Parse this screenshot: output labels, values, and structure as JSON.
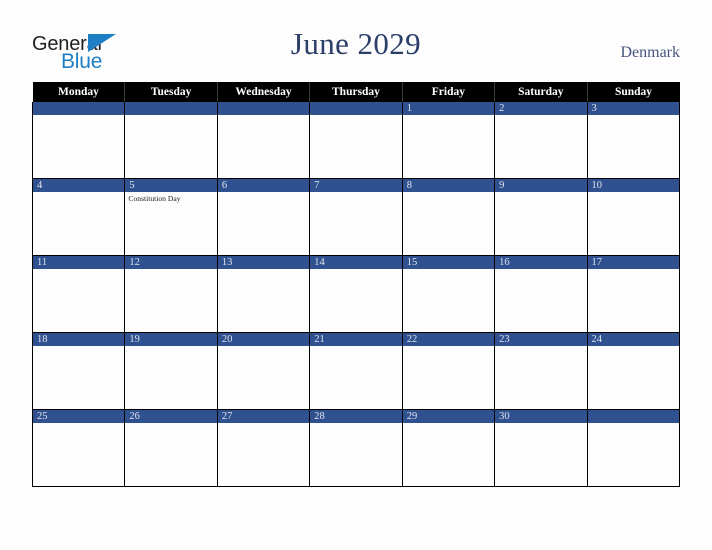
{
  "logo": {
    "word_one": "General",
    "word_two": "Blue",
    "accent_color": "#1e7fc4"
  },
  "header": {
    "title": "June 2029",
    "country": "Denmark",
    "title_color": "#2b3e68"
  },
  "calendar": {
    "weekday_headers": [
      "Monday",
      "Tuesday",
      "Wednesday",
      "Thursday",
      "Friday",
      "Saturday",
      "Sunday"
    ],
    "header_bg": "#000000",
    "day_bar_color": "#2f5190",
    "day_number_color": "#dfe3ec",
    "weeks": [
      [
        {
          "day": "",
          "events": []
        },
        {
          "day": "",
          "events": []
        },
        {
          "day": "",
          "events": []
        },
        {
          "day": "",
          "events": []
        },
        {
          "day": "1",
          "events": []
        },
        {
          "day": "2",
          "events": []
        },
        {
          "day": "3",
          "events": []
        }
      ],
      [
        {
          "day": "4",
          "events": []
        },
        {
          "day": "5",
          "events": [
            "Constitution Day"
          ]
        },
        {
          "day": "6",
          "events": []
        },
        {
          "day": "7",
          "events": []
        },
        {
          "day": "8",
          "events": []
        },
        {
          "day": "9",
          "events": []
        },
        {
          "day": "10",
          "events": []
        }
      ],
      [
        {
          "day": "11",
          "events": []
        },
        {
          "day": "12",
          "events": []
        },
        {
          "day": "13",
          "events": []
        },
        {
          "day": "14",
          "events": []
        },
        {
          "day": "15",
          "events": []
        },
        {
          "day": "16",
          "events": []
        },
        {
          "day": "17",
          "events": []
        }
      ],
      [
        {
          "day": "18",
          "events": []
        },
        {
          "day": "19",
          "events": []
        },
        {
          "day": "20",
          "events": []
        },
        {
          "day": "21",
          "events": []
        },
        {
          "day": "22",
          "events": []
        },
        {
          "day": "23",
          "events": []
        },
        {
          "day": "24",
          "events": []
        }
      ],
      [
        {
          "day": "25",
          "events": []
        },
        {
          "day": "26",
          "events": []
        },
        {
          "day": "27",
          "events": []
        },
        {
          "day": "28",
          "events": []
        },
        {
          "day": "29",
          "events": []
        },
        {
          "day": "30",
          "events": []
        },
        {
          "day": "",
          "events": []
        }
      ]
    ]
  }
}
